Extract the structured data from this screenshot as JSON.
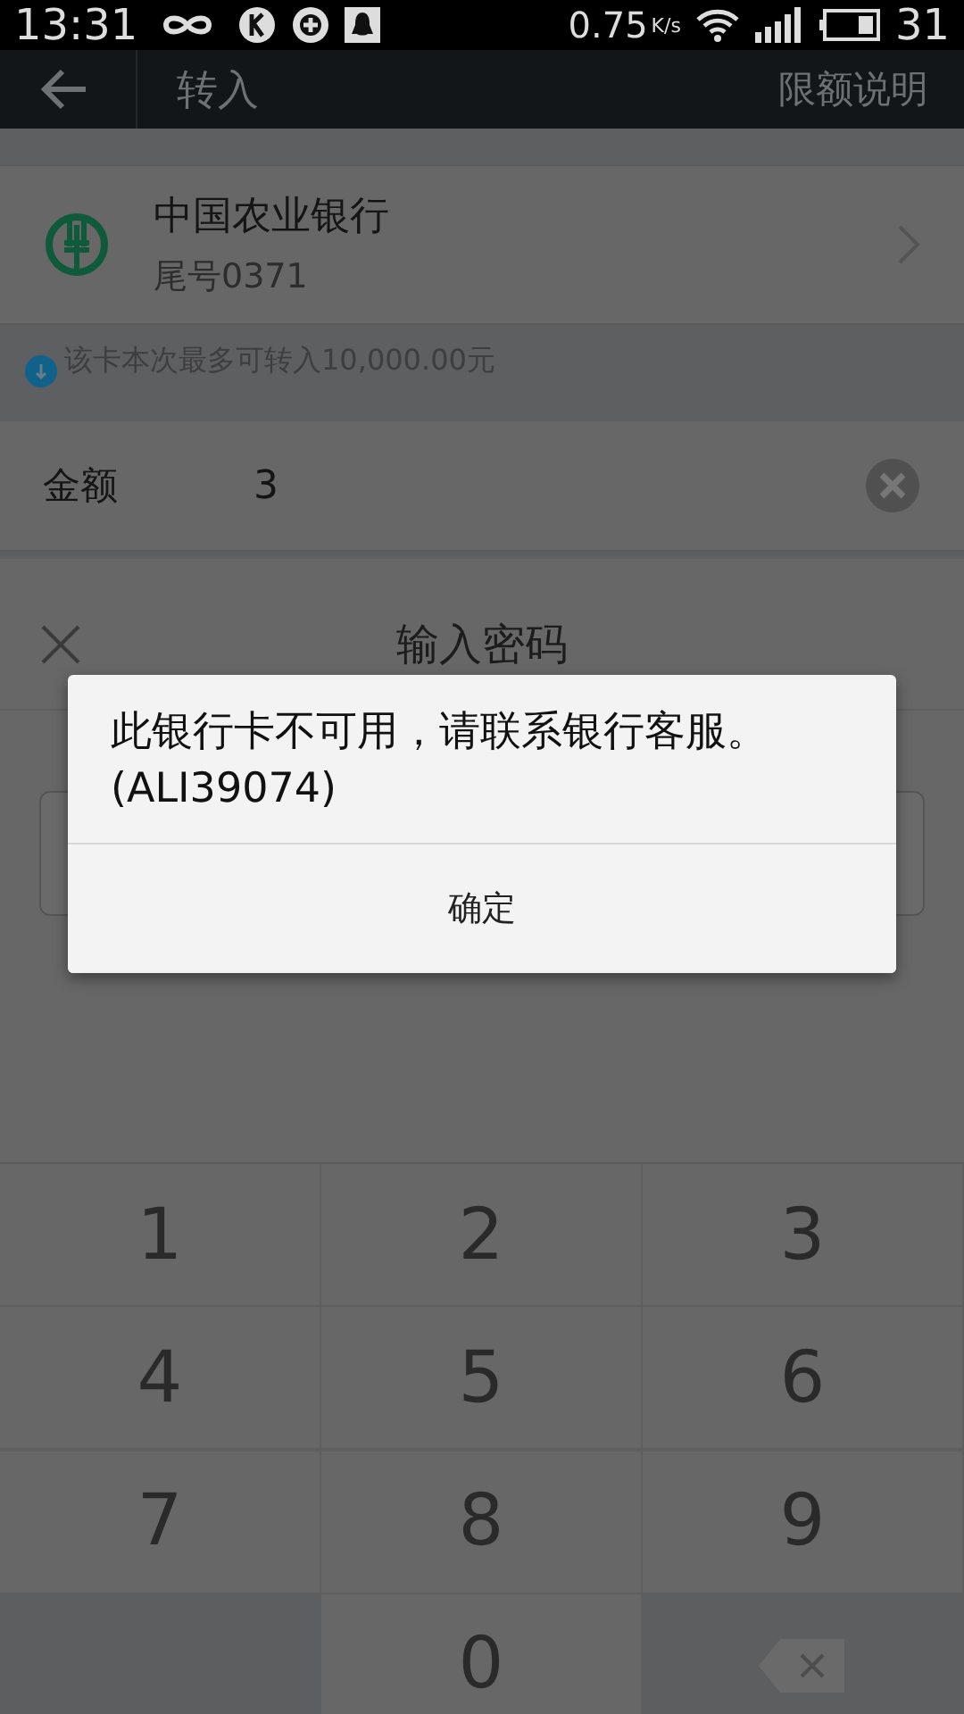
{
  "status_bar": {
    "time": "13:31",
    "speed": "0.75",
    "speed_unit": "K/s",
    "battery": "31"
  },
  "header": {
    "title": "转入",
    "action": "限额说明"
  },
  "bank_card": {
    "name": "中国农业银行",
    "tail": "尾号0371"
  },
  "limit_notice": "该卡本次最多可转入10,000.00元",
  "amount": {
    "label": "金额",
    "value": "3"
  },
  "password_sheet": {
    "title": "输入密码"
  },
  "dialog": {
    "message": "此银行卡不可用，请联系银行客服。(ALI39074)",
    "button": "确定"
  },
  "keypad": [
    {
      "kind": "digit",
      "label": "1"
    },
    {
      "kind": "digit",
      "label": "2"
    },
    {
      "kind": "digit",
      "label": "3"
    },
    {
      "kind": "digit",
      "label": "4"
    },
    {
      "kind": "digit",
      "label": "5"
    },
    {
      "kind": "digit",
      "label": "6"
    },
    {
      "kind": "digit",
      "label": "7"
    },
    {
      "kind": "digit",
      "label": "8"
    },
    {
      "kind": "digit",
      "label": "9"
    },
    {
      "kind": "empty"
    },
    {
      "kind": "digit",
      "label": "0"
    },
    {
      "kind": "delete"
    }
  ]
}
